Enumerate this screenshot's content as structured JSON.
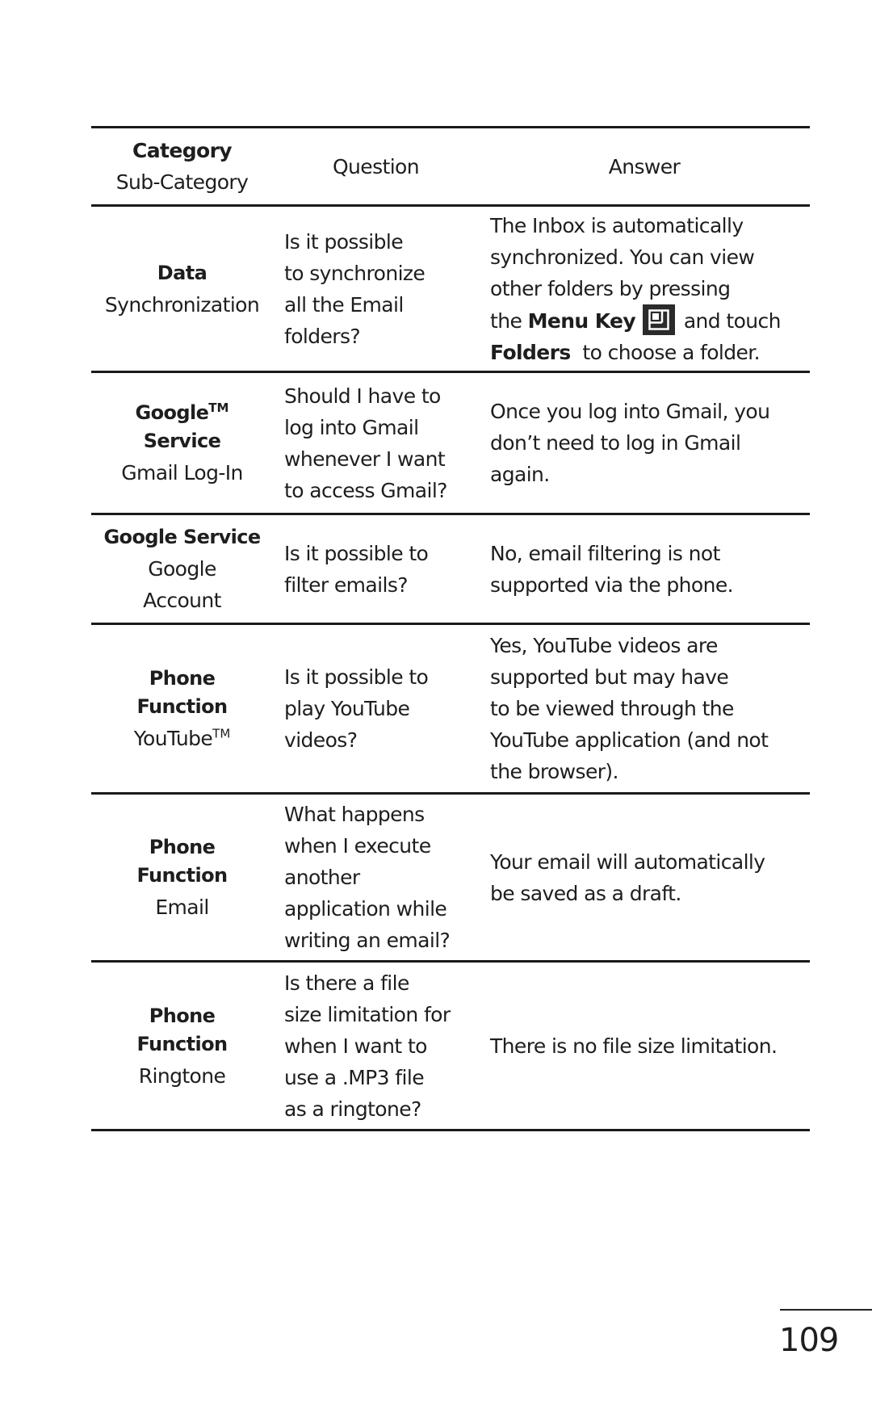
{
  "table": {
    "headers": {
      "category": "Category",
      "sub_category": "Sub-Category",
      "question": "Question",
      "answer": "Answer"
    },
    "rows": [
      {
        "category": "Data",
        "category_tm": "",
        "sub_category": "Synchronization",
        "sub_category_tm": "",
        "question_lines": [
          "Is it possible",
          "to synchronize",
          "all the Email",
          "folders?"
        ],
        "answer_lines": [
          "The Inbox is automatically",
          "synchronized. You can view",
          "other folders by pressing"
        ],
        "answer_rich": {
          "prefix": "the ",
          "bold1": "Menu Key",
          "icon": "menu-key-icon",
          "mid": " and touch",
          "bold2": "Folders",
          "suffix": "  to choose a folder."
        }
      },
      {
        "category": "Google",
        "category_tm": "TM",
        "category_line2": "Service",
        "sub_category": "Gmail Log-In",
        "question_lines": [
          "Should I have to",
          "log into Gmail",
          "whenever I want",
          "to access Gmail?"
        ],
        "answer_lines": [
          "Once you log into Gmail, you",
          "don’t need to log in Gmail",
          "again."
        ]
      },
      {
        "category": "Google Service",
        "sub_category_lines": [
          "Google",
          "Account"
        ],
        "question_lines": [
          "Is it possible to",
          "filter emails?"
        ],
        "answer_lines": [
          "No, email filtering is not",
          "supported via the phone."
        ]
      },
      {
        "category_lines": [
          "Phone",
          "Function"
        ],
        "sub_category": "YouTube",
        "sub_category_tm": "TM",
        "question_lines": [
          "Is it possible to",
          "play YouTube",
          "videos?"
        ],
        "answer_lines": [
          "Yes, YouTube videos are",
          "supported but may have",
          "to be viewed through the",
          "YouTube application (and not",
          "the browser)."
        ]
      },
      {
        "category_lines": [
          "Phone",
          "Function"
        ],
        "sub_category": "Email",
        "question_lines": [
          "What happens",
          "when I execute",
          "another",
          "application while",
          "writing an email?"
        ],
        "answer_lines": [
          "Your email will automatically",
          "be saved as a draft."
        ]
      },
      {
        "category_lines": [
          "Phone",
          "Function"
        ],
        "sub_category": "Ringtone",
        "question_lines": [
          "Is there a file",
          "size limitation for",
          "when I want to",
          "use a .MP3 file",
          "as a ringtone?"
        ],
        "answer_lines": [
          "There is no file size limitation."
        ]
      }
    ]
  },
  "footer": {
    "page_number": "109"
  }
}
